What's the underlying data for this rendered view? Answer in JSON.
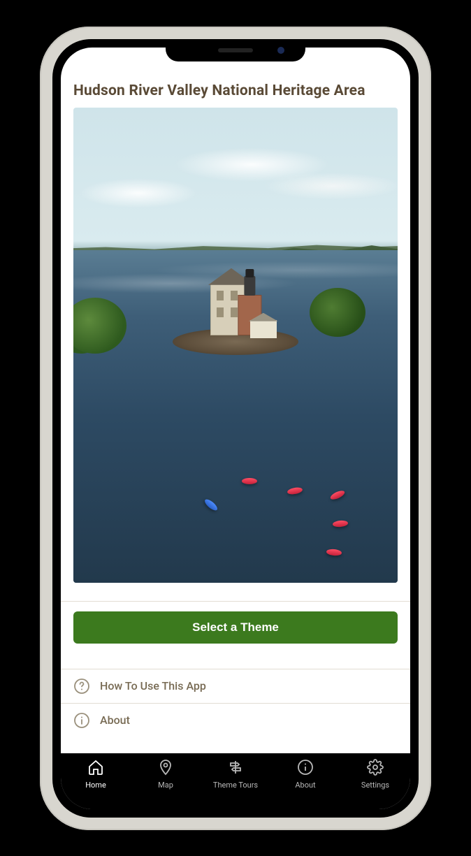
{
  "header": {
    "title": "Hudson River Valley National Heritage Area"
  },
  "actions": {
    "select_theme_label": "Select a Theme"
  },
  "links": [
    {
      "icon": "question-circle-icon",
      "label": "How To Use This App"
    },
    {
      "icon": "info-circle-icon",
      "label": "About"
    }
  ],
  "tabbar": [
    {
      "icon": "home-icon",
      "label": "Home",
      "active": true
    },
    {
      "icon": "map-pin-icon",
      "label": "Map",
      "active": false
    },
    {
      "icon": "signpost-icon",
      "label": "Theme Tours",
      "active": false
    },
    {
      "icon": "info-circle-icon",
      "label": "About",
      "active": false
    },
    {
      "icon": "gear-icon",
      "label": "Settings",
      "active": false
    }
  ],
  "colors": {
    "accent_green": "#3c7a1e",
    "brand_brown": "#5a4a36"
  }
}
